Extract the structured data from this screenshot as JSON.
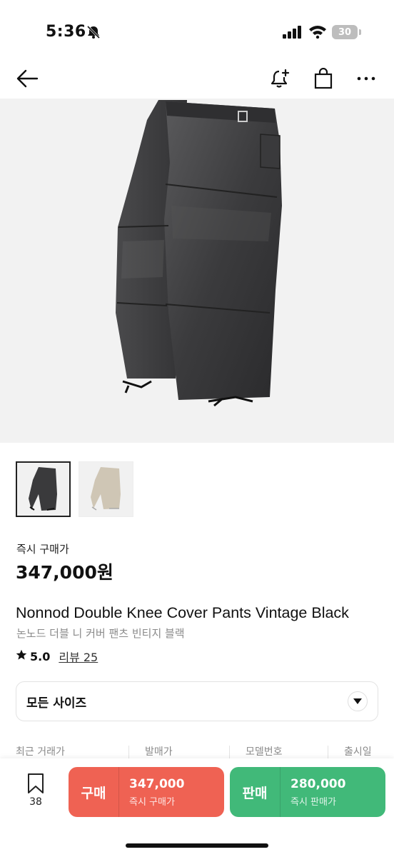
{
  "status_bar": {
    "time": "5:36",
    "battery": "30",
    "icons": [
      "bell-off-icon",
      "signal-icon",
      "wifi-icon",
      "battery-icon"
    ]
  },
  "nav": {
    "icons": [
      "back-arrow-icon",
      "bell-plus-icon",
      "shopping-bag-icon",
      "more-icon"
    ]
  },
  "product": {
    "price_label": "즉시 구매가",
    "price": "347,000원",
    "title_en": "Nonnod Double Knee Cover Pants Vintage Black",
    "title_ko": "논노드 더블 니 커버 팬츠 빈티지 블랙",
    "rating": "5.0",
    "review": "리뷰 25",
    "thumbnails": [
      "black",
      "beige"
    ]
  },
  "size_select": {
    "label": "모든 사이즈"
  },
  "info_row": {
    "recent_trade": "최근 거래가",
    "release_price": "발매가",
    "model_no": "모델번호",
    "release_date": "출시일"
  },
  "bottom_bar": {
    "bookmark_count": "38",
    "buy": {
      "action": "구매",
      "amount": "347,000",
      "sub": "즉시 구매가"
    },
    "sell": {
      "action": "판매",
      "amount": "280,000",
      "sub": "즉시 판매가"
    }
  },
  "colors": {
    "buy": "#ef6253",
    "sell": "#41b979",
    "hero_bg": "#f2f2f2"
  }
}
